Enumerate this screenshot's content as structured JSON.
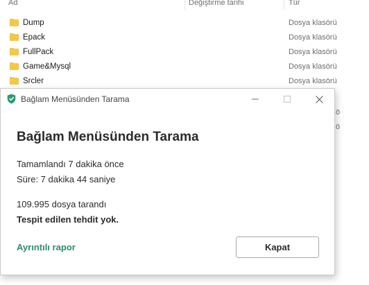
{
  "explorer": {
    "columns": {
      "name": "Ad",
      "modified": "Değiştirme tarihi",
      "type": "Tür"
    },
    "rows": [
      {
        "name": "Dump",
        "type": "Dosya klasörü"
      },
      {
        "name": "Epack",
        "type": "Dosya klasörü"
      },
      {
        "name": "FullPack",
        "type": "Dosya klasörü"
      },
      {
        "name": "Game&Mysql",
        "type": "Dosya klasörü"
      },
      {
        "name": "Srcler",
        "type": "Dosya klasörü"
      }
    ],
    "folder_color": "#f5c842"
  },
  "dialog": {
    "title": "Bağlam Menüsünden Tarama",
    "heading": "Bağlam Menüsünden Tarama",
    "completed": "Tamamlandı 7 dakika önce",
    "duration": "Süre: 7 dakika 44 saniye",
    "files_scanned": "109.995 dosya tarandı",
    "threats": "Tespit edilen tehdit yok.",
    "report_link": "Ayrıntılı rapor",
    "close_button": "Kapat",
    "accent_color": "#2e8b6e",
    "shield_color": "#2e9b73",
    "icons": {
      "app": "shield-icon",
      "minimize": "minimize-icon",
      "maximize": "maximize-icon",
      "close": "close-icon"
    }
  }
}
